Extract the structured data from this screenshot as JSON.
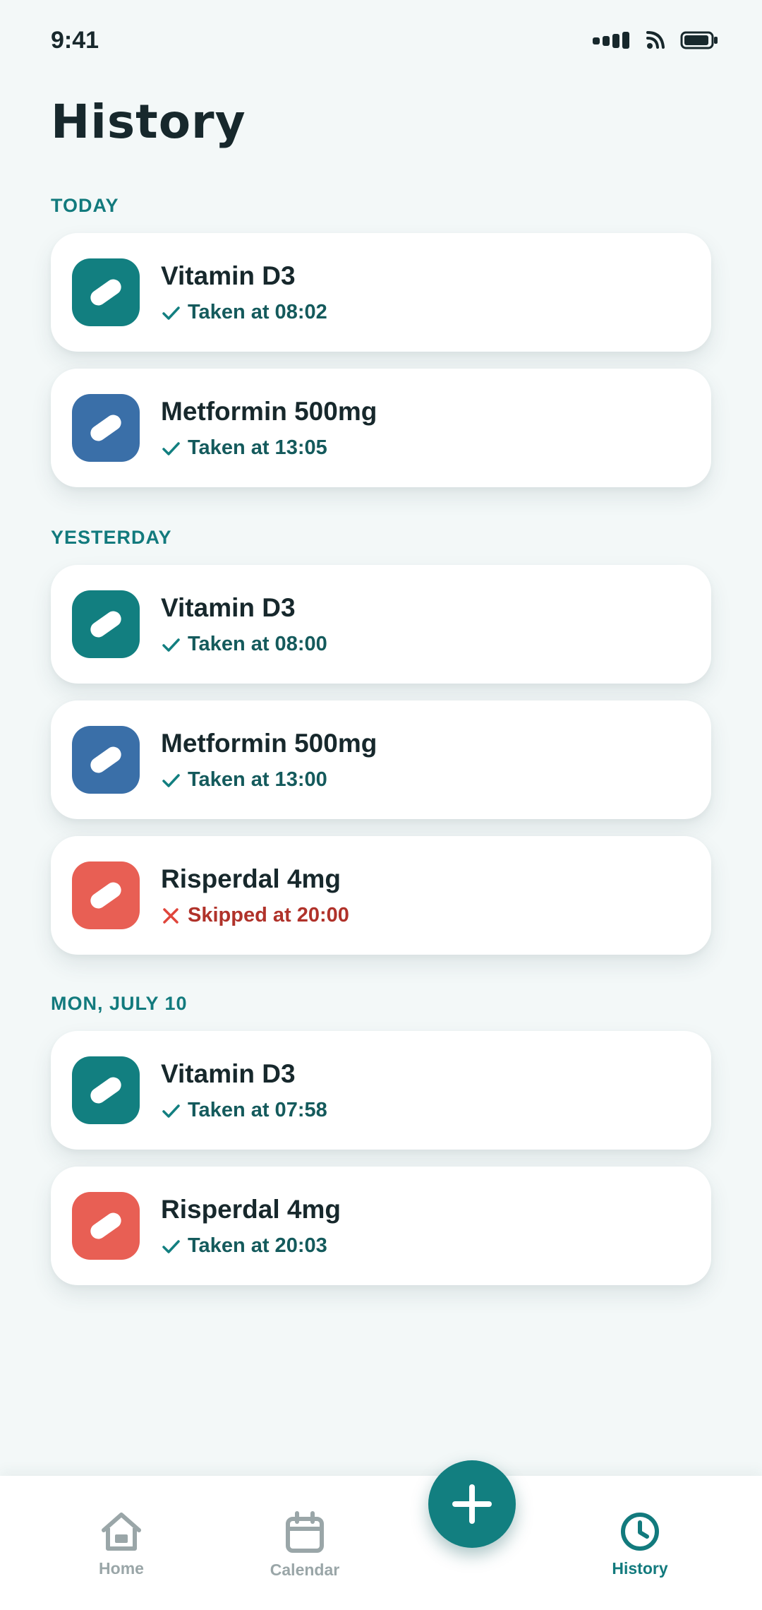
{
  "status_bar": {
    "time": "9:41"
  },
  "page_title": "History",
  "sections": [
    {
      "label": "TODAY",
      "entries": [
        {
          "name": "Vitamin D3",
          "status_text": "Taken at 08:02",
          "status": "taken",
          "color": "#127f80"
        },
        {
          "name": "Metformin 500mg",
          "status_text": "Taken at 13:05",
          "status": "taken",
          "color": "#3a6fa8"
        }
      ]
    },
    {
      "label": "YESTERDAY",
      "entries": [
        {
          "name": "Vitamin D3",
          "status_text": "Taken at 08:00",
          "status": "taken",
          "color": "#127f80"
        },
        {
          "name": "Metformin 500mg",
          "status_text": "Taken at 13:00",
          "status": "taken",
          "color": "#3a6fa8"
        },
        {
          "name": "Risperdal 4mg",
          "status_text": "Skipped at 20:00",
          "status": "skipped",
          "color": "#e85f54"
        }
      ]
    },
    {
      "label": "MON, JULY 10",
      "entries": [
        {
          "name": "Vitamin D3",
          "status_text": "Taken at 07:58",
          "status": "taken",
          "color": "#127f80"
        },
        {
          "name": "Risperdal 4mg",
          "status_text": "Taken at 20:03",
          "status": "taken",
          "color": "#e85f54"
        }
      ]
    }
  ],
  "bottom_nav": {
    "home": {
      "label": "Home",
      "icon": "home-icon",
      "active": false
    },
    "calendar": {
      "label": "Calendar",
      "icon": "calendar-icon",
      "active": false
    },
    "add": {
      "icon": "plus-icon"
    },
    "history": {
      "label": "History",
      "icon": "clock-icon",
      "active": true
    }
  },
  "colors": {
    "accent": "#127f80",
    "background": "#f3f8f8",
    "taken_text": "#145a5c",
    "skipped_text": "#b0322a",
    "inactive_nav": "#9aa6a8"
  }
}
